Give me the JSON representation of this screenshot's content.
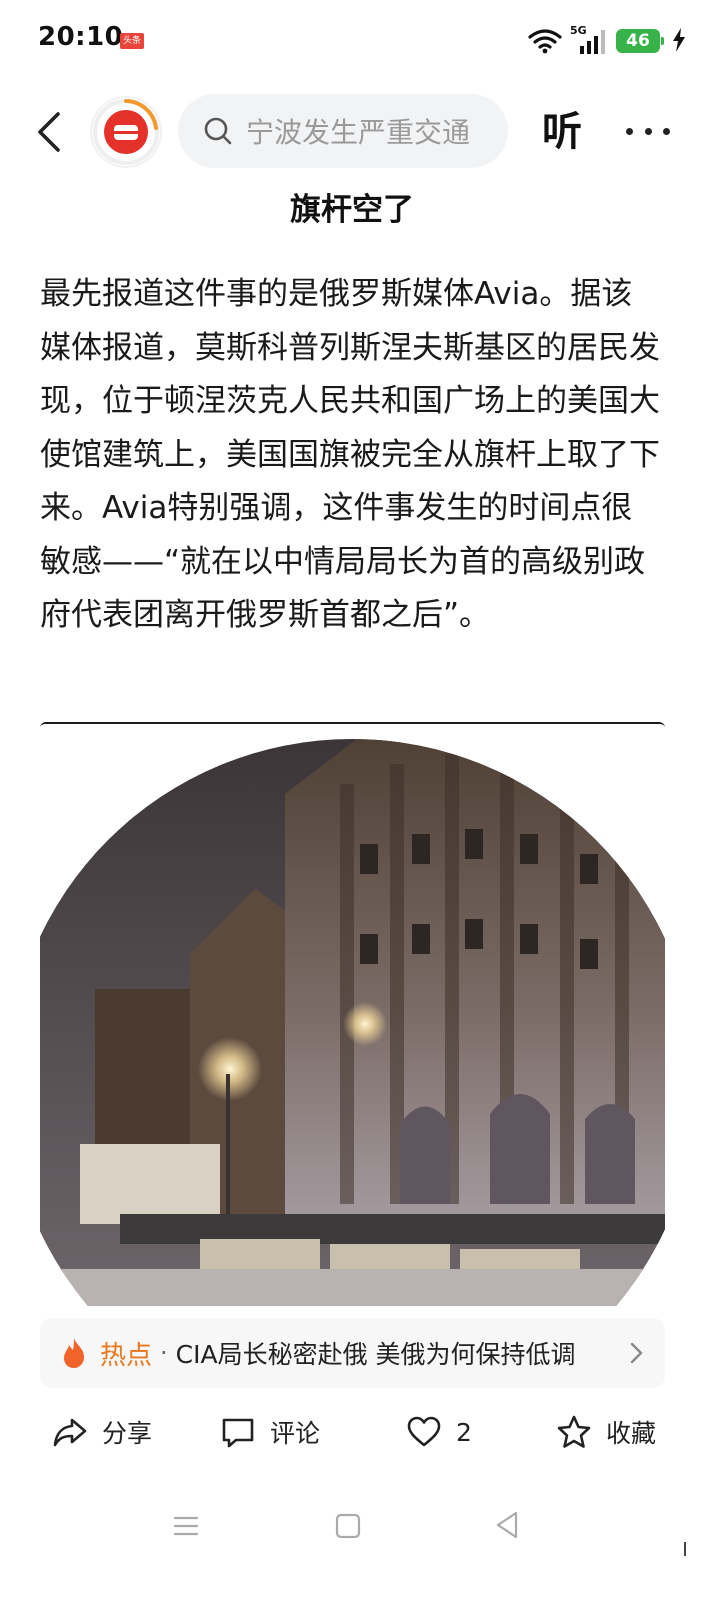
{
  "status_bar": {
    "time": "20:10",
    "app_badge": "头条",
    "network": "5G",
    "battery": "46",
    "icons": [
      "wifi-icon",
      "signal-icon",
      "battery-icon",
      "charging-icon"
    ]
  },
  "top_nav": {
    "search_placeholder": "宁波发生严重交通",
    "listen_label": "听",
    "icons": [
      "back-icon",
      "app-logo",
      "search-icon",
      "more-icon"
    ]
  },
  "article": {
    "title": "旗杆空了",
    "body": "最先报道这件事的是俄罗斯媒体Avia。据该媒体报道，莫斯科普列斯涅夫斯基区的居民发现，位于顿涅茨克人民共和国广场上的美国大使馆建筑上，美国国旗被完全从旗杆上取了下来。Avia特别强调，这件事发生的时间点很敏感——“就在以中情局局长为首的高级别政府代表团离开俄罗斯首都之后”。"
  },
  "hot_topic": {
    "label": "热点",
    "separator": "·",
    "text": "CIA局长秘密赴俄 美俄为何保持低调"
  },
  "actions": {
    "share": "分享",
    "comment": "评论",
    "like_count": "2",
    "favorite": "收藏"
  },
  "colors": {
    "brand_red": "#e4322b",
    "hot_orange": "#e7781e",
    "battery_green": "#38b34a"
  }
}
